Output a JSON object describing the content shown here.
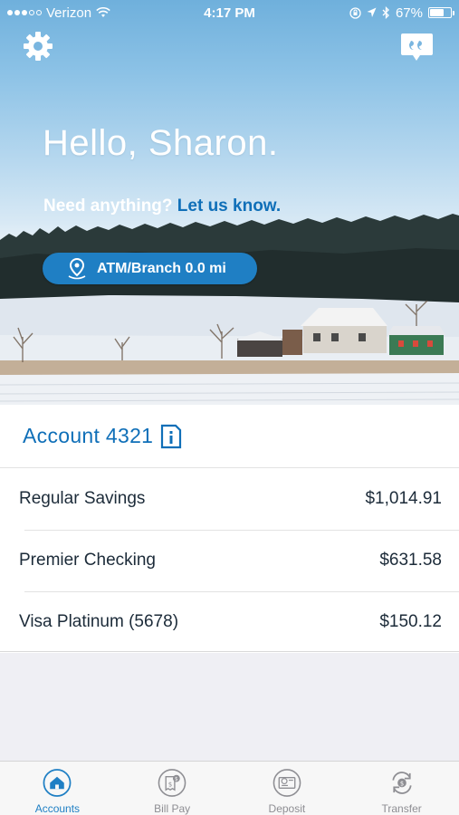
{
  "status_bar": {
    "carrier": "Verizon",
    "time": "4:17 PM",
    "battery": "67%",
    "battery_level": 0.67
  },
  "header": {
    "settings_icon": "gear-icon",
    "chat_icon": "quote-bubble-icon"
  },
  "hero": {
    "greeting": "Hello, Sharon.",
    "need_text": "Need anything?",
    "need_link": "Let us know.",
    "atm_button": "ATM/Branch 0.0 mi",
    "atm_icon": "location-pin-icon"
  },
  "account": {
    "title": "Account 4321",
    "info_icon": "info-icon",
    "items": [
      {
        "name": "Regular Savings",
        "balance": "$1,014.91"
      },
      {
        "name": "Premier Checking",
        "balance": "$631.58"
      },
      {
        "name": "Visa Platinum (5678)",
        "balance": "$150.12"
      }
    ]
  },
  "tabs": [
    {
      "label": "Accounts",
      "icon": "home-icon",
      "active": true
    },
    {
      "label": "Bill Pay",
      "icon": "bill-pay-icon",
      "active": false
    },
    {
      "label": "Deposit",
      "icon": "deposit-check-icon",
      "active": false
    },
    {
      "label": "Transfer",
      "icon": "transfer-icon",
      "active": false
    }
  ],
  "colors": {
    "brand_blue": "#1f7fc4",
    "link_blue": "#0f6fb8",
    "text_dark": "#1c2b39",
    "tab_inactive": "#8e8e93"
  }
}
